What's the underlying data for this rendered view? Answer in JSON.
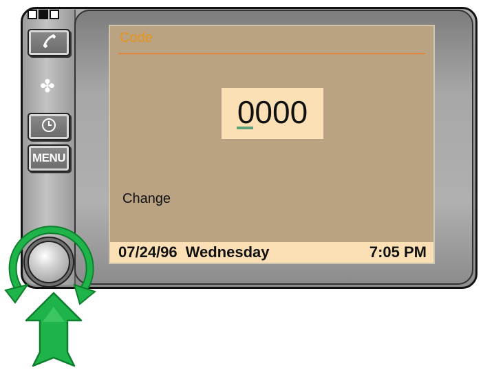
{
  "device": {
    "indicators": [
      "off",
      "on",
      "off"
    ],
    "buttons": {
      "phone_icon": "phone-icon",
      "fan_icon": "fan-icon",
      "clock_icon": "clock-icon",
      "menu_label": "MENU"
    }
  },
  "screen": {
    "title": "Code",
    "code_value": "0000",
    "action_label": "Change",
    "status": {
      "date": "07/24/96",
      "day": "Wednesday",
      "time": "7:05 PM"
    }
  },
  "colors": {
    "screen_background": "#b9a383",
    "highlight_background": "#fbe0b6",
    "title_color": "#e8951a",
    "cursor_color": "#5ea27c",
    "arrow_color": "#14a23c"
  }
}
